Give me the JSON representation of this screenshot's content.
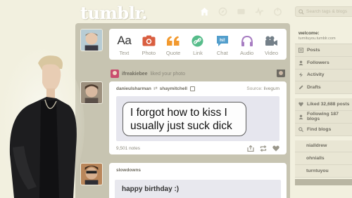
{
  "header": {
    "logo": "tumblr.",
    "search_placeholder": "Search tags & blogs",
    "nav_icons": [
      "home-icon",
      "explore-icon",
      "messages-icon",
      "activity-icon",
      "account-icon"
    ]
  },
  "post_types": [
    {
      "label": "Text",
      "icon": "text-icon",
      "color": "#444444"
    },
    {
      "label": "Photo",
      "icon": "photo-icon",
      "color": "#d95e40"
    },
    {
      "label": "Quote",
      "icon": "quote-icon",
      "color": "#f2992e"
    },
    {
      "label": "Link",
      "icon": "link-icon",
      "color": "#56bc8a"
    },
    {
      "label": "Chat",
      "icon": "chat-icon",
      "color": "#529ecc"
    },
    {
      "label": "Audio",
      "icon": "audio-icon",
      "color": "#a77dc2"
    },
    {
      "label": "Video",
      "icon": "video-icon",
      "color": "#748089"
    }
  ],
  "activity": {
    "user": "ifreakiebee",
    "action": "liked your photo"
  },
  "post1": {
    "blog": "danieulsharman",
    "reblogged_from": "shaymitchell",
    "source_label": "Source:",
    "source": "livegum",
    "quote": "I forgot how to kiss I usually just suck dick",
    "notes": "9,501 notes"
  },
  "post2": {
    "blog": "slowdowns",
    "text": "happy birthday :)"
  },
  "sidebar": {
    "welcome": "welcome:",
    "url": "turnituyou.tumblr.com",
    "items": [
      {
        "label": "Posts",
        "icon": "posts-icon"
      },
      {
        "label": "Followers",
        "icon": "followers-icon"
      },
      {
        "label": "Activity",
        "icon": "activity-icon"
      },
      {
        "label": "Drafts",
        "icon": "drafts-icon"
      }
    ],
    "stats": [
      {
        "label": "Liked 32,688 posts",
        "icon": "heart-icon"
      },
      {
        "label": "Following 187 blogs",
        "icon": "user-icon"
      },
      {
        "label": "Find blogs",
        "icon": "find-icon"
      }
    ],
    "blogs": [
      "nialldrew",
      "ohnialls",
      "turntuyou"
    ]
  },
  "colors": {
    "background": "#f2f0df",
    "dashboard": "#c7c4b1",
    "sidebar_item": "#e6e3d1"
  }
}
